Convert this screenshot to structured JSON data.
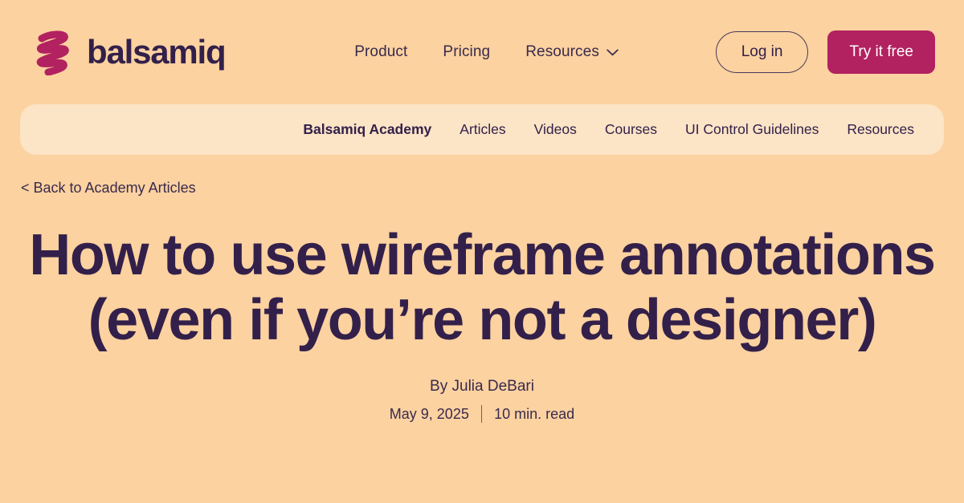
{
  "theme": {
    "page_background": "#fbd2a0",
    "subnav_background": "#fce4c6",
    "accent_magenta": "#b22160",
    "text_dark_purple": "#33204a"
  },
  "header": {
    "brand_name": "balsamiq",
    "logo_icon": "balsamiq-scribble-mark",
    "nav": [
      {
        "label": "Product",
        "icon": null
      },
      {
        "label": "Pricing",
        "icon": null
      },
      {
        "label": "Resources",
        "icon": "chevron-down-icon"
      }
    ],
    "login_label": "Log in",
    "try_label": "Try it free"
  },
  "subnav": {
    "items": [
      {
        "label": "Balsamiq Academy",
        "active": true
      },
      {
        "label": "Articles",
        "active": false
      },
      {
        "label": "Videos",
        "active": false
      },
      {
        "label": "Courses",
        "active": false
      },
      {
        "label": "UI Control Guidelines",
        "active": false
      },
      {
        "label": "Resources",
        "active": false
      }
    ]
  },
  "breadcrumb": {
    "back_label": "< Back to Academy Articles"
  },
  "article": {
    "title": "How to use wireframe annotations (even if you’re not a designer)",
    "byline": "By Julia DeBari",
    "date": "May 9, 2025",
    "read_time": "10 min. read"
  }
}
